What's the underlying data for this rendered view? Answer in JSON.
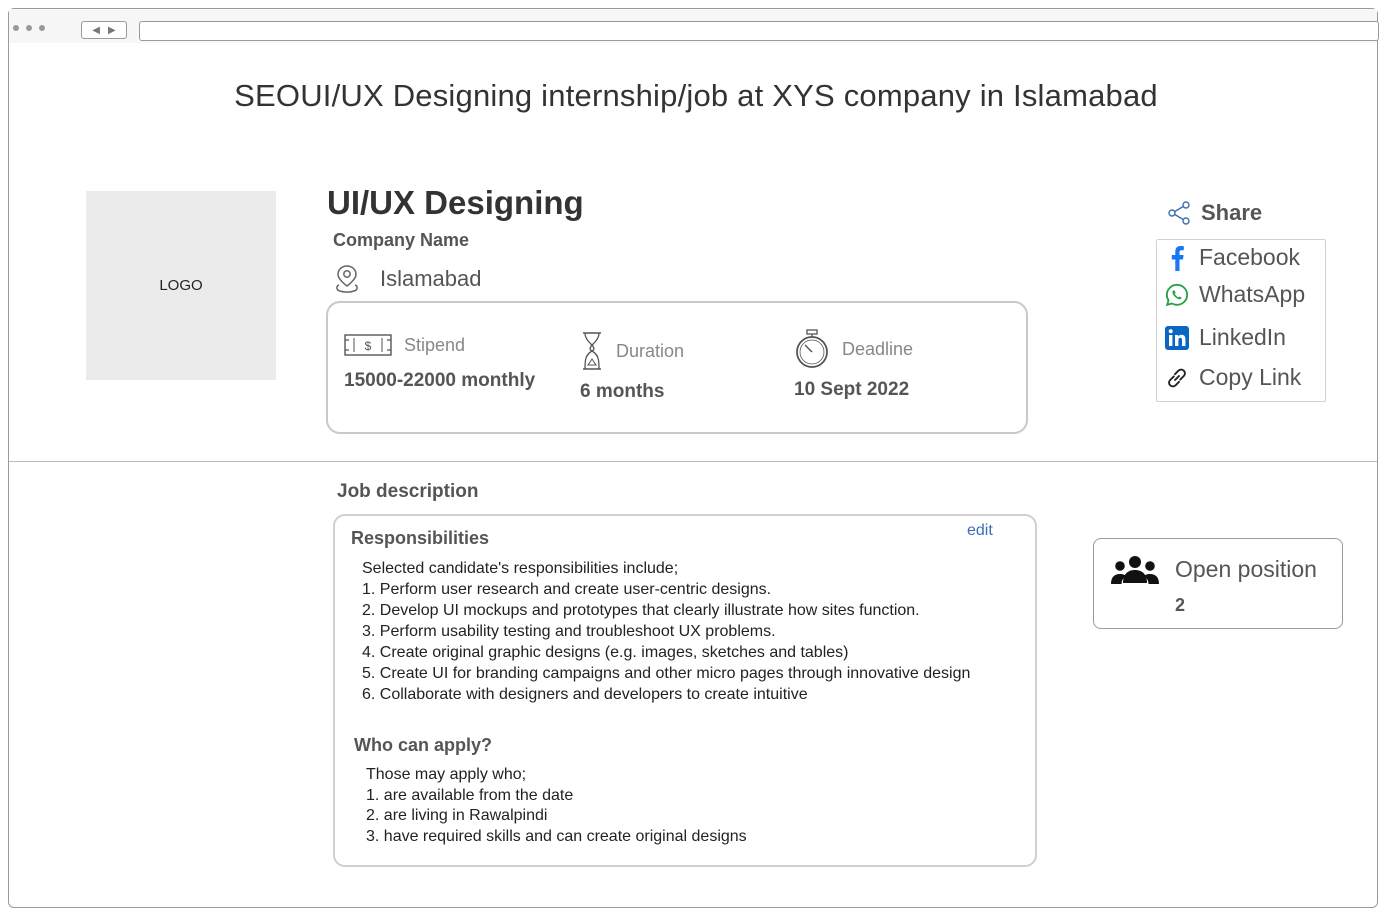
{
  "page": {
    "heading": "SEOUI/UX Designing internship/job at XYS company in Islamabad"
  },
  "logo": {
    "label": "LOGO"
  },
  "job": {
    "title": "UI/UX Designing",
    "company": "Company Name",
    "location": "Islamabad",
    "stipend": {
      "label": "Stipend",
      "value": "15000-22000 monthly",
      "icon": "money-icon"
    },
    "duration": {
      "label": "Duration",
      "value": "6 months",
      "icon": "hourglass-icon"
    },
    "deadline": {
      "label": "Deadline",
      "value": "10 Sept 2022",
      "icon": "stopwatch-icon"
    }
  },
  "share": {
    "label": "Share",
    "items": [
      {
        "label": "Facebook",
        "icon": "facebook-icon"
      },
      {
        "label": "WhatsApp",
        "icon": "whatsapp-icon"
      },
      {
        "label": "LinkedIn",
        "icon": "linkedin-icon"
      },
      {
        "label": "Copy Link",
        "icon": "link-icon"
      }
    ]
  },
  "description": {
    "heading": "Job description",
    "edit_label": "edit",
    "responsibilities": {
      "heading": "Responsibilities",
      "lines": [
        "Selected candidate's responsibilities include;",
        "1. Perform user research and create user-centric designs.",
        "2. Develop UI mockups and prototypes that clearly illustrate how sites function.",
        "3. Perform usability testing and troubleshoot UX problems.",
        "4. Create original graphic designs (e.g. images, sketches and tables)",
        "5. Create UI for branding campaigns and other micro pages through innovative design",
        "6. Collaborate with designers and developers to create intuitive"
      ]
    },
    "who": {
      "heading": "Who can apply?",
      "lines": [
        "Those may apply who;",
        "1. are available from the date",
        "2. are living in Rawalpindi",
        "3. have required skills and can create original designs"
      ]
    }
  },
  "open_position": {
    "label": "Open position",
    "value": "2"
  },
  "colors": {
    "facebook": "#1877f2",
    "whatsapp": "#25a244",
    "linkedin": "#0a66c2",
    "link_accent": "#3b6fb0"
  }
}
